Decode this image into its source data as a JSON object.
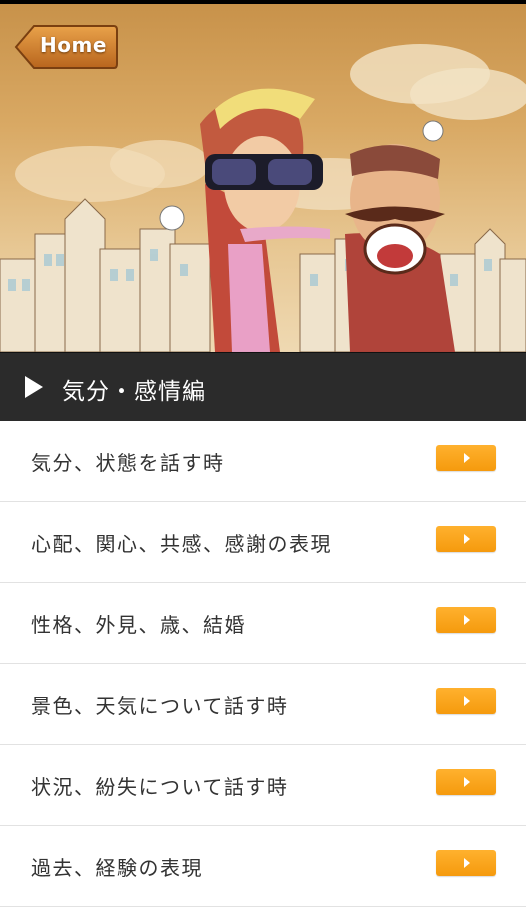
{
  "header": {
    "home_label": "Home"
  },
  "section": {
    "title": "気分・感情編"
  },
  "colors": {
    "accent_orange": "#f5a01a",
    "header_bg": "#2b2b2b",
    "hero_sky": "#d9a964"
  },
  "items": [
    {
      "label": "気分、状態を話す時",
      "icon": "play-arrow-icon"
    },
    {
      "label": "心配、関心、共感、感謝の表現",
      "icon": "play-arrow-icon"
    },
    {
      "label": "性格、外見、歳、結婚",
      "icon": "play-arrow-icon"
    },
    {
      "label": "景色、天気について話す時",
      "icon": "play-arrow-icon"
    },
    {
      "label": "状況、紛失について話す時",
      "icon": "play-arrow-icon"
    },
    {
      "label": "過去、経験の表現",
      "icon": "play-arrow-icon"
    }
  ]
}
